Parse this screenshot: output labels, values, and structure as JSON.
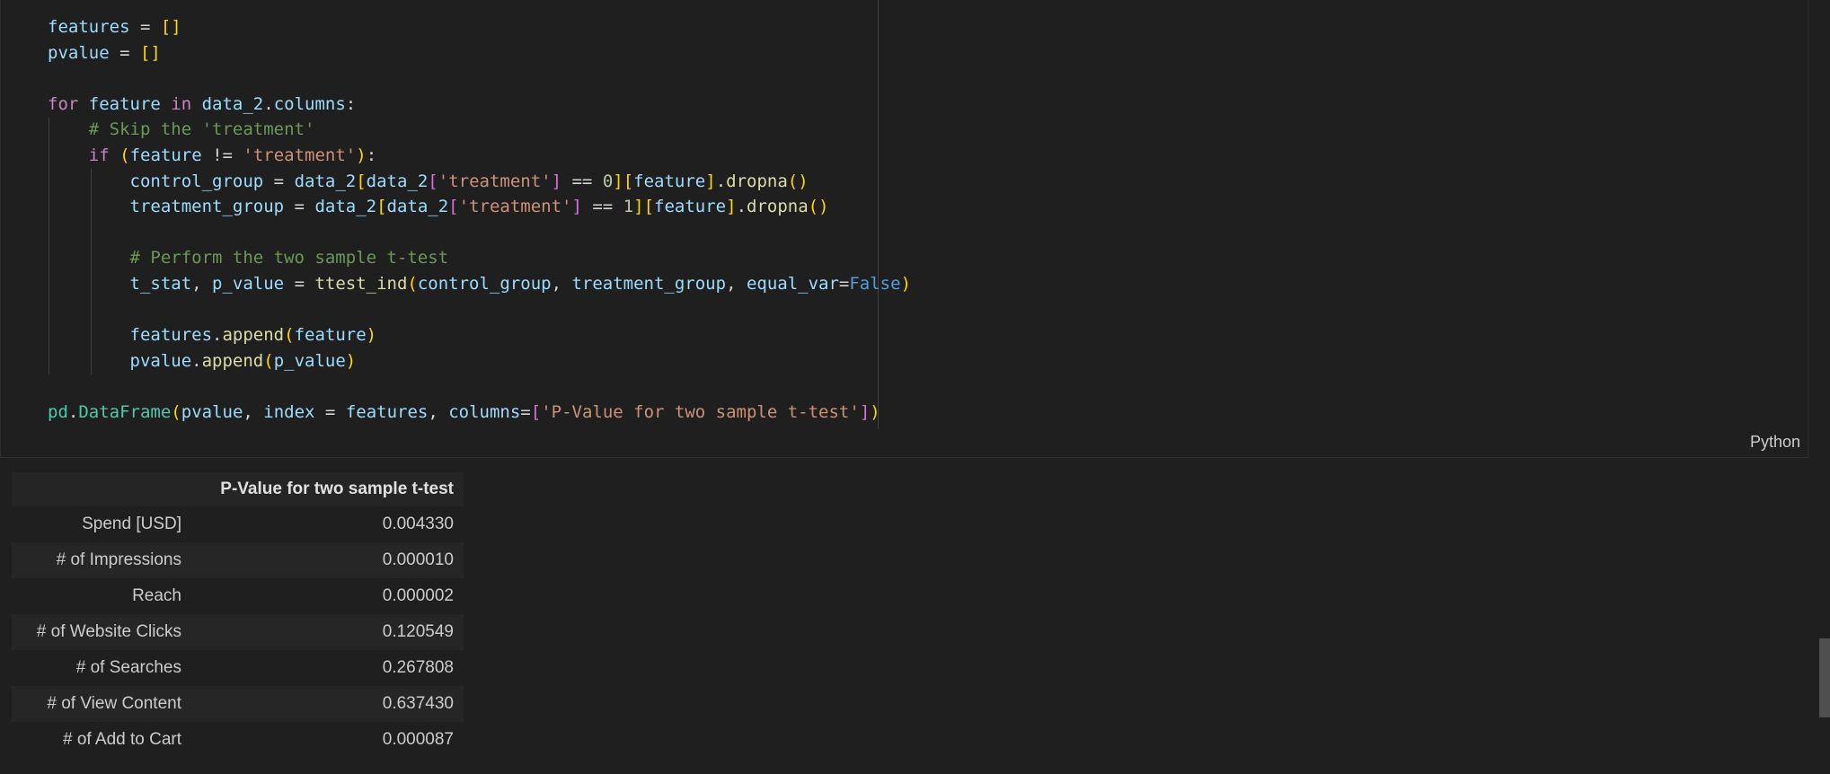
{
  "editor": {
    "language": "Python",
    "lines": [
      [
        [
          "v",
          "features"
        ],
        [
          "op",
          " = "
        ],
        [
          "b1",
          "[]"
        ]
      ],
      [
        [
          "v",
          "pvalue"
        ],
        [
          "op",
          " = "
        ],
        [
          "b1",
          "[]"
        ]
      ],
      [],
      [
        [
          "k",
          "for"
        ],
        [
          "v",
          " feature "
        ],
        [
          "k",
          "in"
        ],
        [
          "v",
          " data_2"
        ],
        [
          "op",
          "."
        ],
        [
          "v",
          "columns"
        ],
        [
          "op",
          ":"
        ]
      ],
      [
        [
          "op",
          "    "
        ],
        [
          "c",
          "# Skip the 'treatment'"
        ]
      ],
      [
        [
          "op",
          "    "
        ],
        [
          "k",
          "if"
        ],
        [
          "op",
          " "
        ],
        [
          "b1",
          "("
        ],
        [
          "v",
          "feature"
        ],
        [
          "op",
          " != "
        ],
        [
          "s",
          "'treatment'"
        ],
        [
          "b1",
          ")"
        ],
        [
          "op",
          ":"
        ]
      ],
      [
        [
          "op",
          "        "
        ],
        [
          "v",
          "control_group"
        ],
        [
          "op",
          " = "
        ],
        [
          "v",
          "data_2"
        ],
        [
          "b1",
          "["
        ],
        [
          "v",
          "data_2"
        ],
        [
          "b2",
          "["
        ],
        [
          "s",
          "'treatment'"
        ],
        [
          "b2",
          "]"
        ],
        [
          "op",
          " == "
        ],
        [
          "n",
          "0"
        ],
        [
          "b1",
          "]["
        ],
        [
          "v",
          "feature"
        ],
        [
          "b1",
          "]"
        ],
        [
          "op",
          "."
        ],
        [
          "f",
          "dropna"
        ],
        [
          "b1",
          "()"
        ]
      ],
      [
        [
          "op",
          "        "
        ],
        [
          "v",
          "treatment_group"
        ],
        [
          "op",
          " = "
        ],
        [
          "v",
          "data_2"
        ],
        [
          "b1",
          "["
        ],
        [
          "v",
          "data_2"
        ],
        [
          "b2",
          "["
        ],
        [
          "s",
          "'treatment'"
        ],
        [
          "b2",
          "]"
        ],
        [
          "op",
          " == "
        ],
        [
          "n",
          "1"
        ],
        [
          "b1",
          "]["
        ],
        [
          "v",
          "feature"
        ],
        [
          "b1",
          "]"
        ],
        [
          "op",
          "."
        ],
        [
          "f",
          "dropna"
        ],
        [
          "b1",
          "()"
        ]
      ],
      [],
      [
        [
          "op",
          "        "
        ],
        [
          "c",
          "# Perform the two sample t-test"
        ]
      ],
      [
        [
          "op",
          "        "
        ],
        [
          "v",
          "t_stat"
        ],
        [
          "op",
          ", "
        ],
        [
          "v",
          "p_value"
        ],
        [
          "op",
          " = "
        ],
        [
          "f",
          "ttest_ind"
        ],
        [
          "b1",
          "("
        ],
        [
          "v",
          "control_group"
        ],
        [
          "op",
          ", "
        ],
        [
          "v",
          "treatment_group"
        ],
        [
          "op",
          ", "
        ],
        [
          "v",
          "equal_var"
        ],
        [
          "op",
          "="
        ],
        [
          "kw",
          "False"
        ],
        [
          "b1",
          ")"
        ]
      ],
      [],
      [
        [
          "op",
          "        "
        ],
        [
          "v",
          "features"
        ],
        [
          "op",
          "."
        ],
        [
          "f",
          "append"
        ],
        [
          "b1",
          "("
        ],
        [
          "v",
          "feature"
        ],
        [
          "b1",
          ")"
        ]
      ],
      [
        [
          "op",
          "        "
        ],
        [
          "v",
          "pvalue"
        ],
        [
          "op",
          "."
        ],
        [
          "f",
          "append"
        ],
        [
          "b1",
          "("
        ],
        [
          "v",
          "p_value"
        ],
        [
          "b1",
          ")"
        ]
      ],
      [],
      [
        [
          "cl",
          "pd"
        ],
        [
          "op",
          "."
        ],
        [
          "cl",
          "DataFrame"
        ],
        [
          "b1",
          "("
        ],
        [
          "v",
          "pvalue"
        ],
        [
          "op",
          ", "
        ],
        [
          "v",
          "index"
        ],
        [
          "op",
          " = "
        ],
        [
          "v",
          "features"
        ],
        [
          "op",
          ", "
        ],
        [
          "v",
          "columns"
        ],
        [
          "op",
          "="
        ],
        [
          "b2",
          "["
        ],
        [
          "s",
          "'P-Value for two sample t-test'"
        ],
        [
          "b2",
          "]"
        ],
        [
          "b1",
          ")"
        ]
      ]
    ]
  },
  "output_table": {
    "header": "P-Value for two sample t-test",
    "rows": [
      {
        "index": "Spend [USD]",
        "value": "0.004330"
      },
      {
        "index": "# of Impressions",
        "value": "0.000010"
      },
      {
        "index": "Reach",
        "value": "0.000002"
      },
      {
        "index": "# of Website Clicks",
        "value": "0.120549"
      },
      {
        "index": "# of Searches",
        "value": "0.267808"
      },
      {
        "index": "# of View Content",
        "value": "0.637430"
      },
      {
        "index": "# of Add to Cart",
        "value": "0.000087"
      }
    ]
  }
}
